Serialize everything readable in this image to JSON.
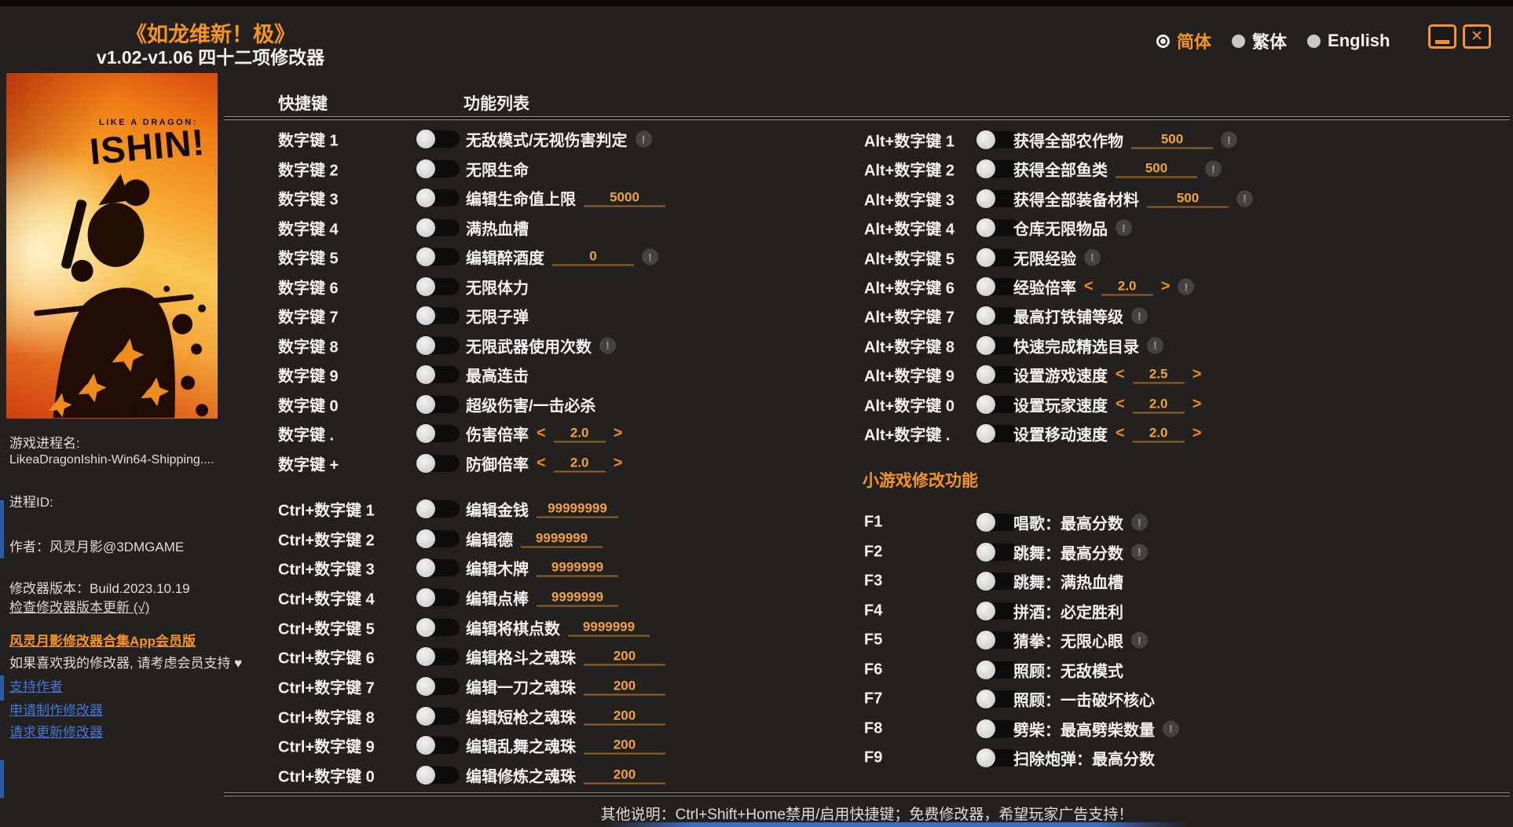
{
  "colors": {
    "accent": "#f7941d",
    "value_orange": "#f2a33c",
    "link_blue": "#4677d4"
  },
  "ui": {
    "spinner_left": "<",
    "spinner_right": ">",
    "warn_glyph": "!",
    "close_glyph": "✕"
  },
  "window": {
    "title": "《如龙维新！极》",
    "subtitle": "v1.02-v1.06 四十二项修改器",
    "languages": [
      {
        "label": "简体",
        "selected": true
      },
      {
        "label": "繁体",
        "selected": false
      },
      {
        "label": "English",
        "selected": false
      }
    ]
  },
  "cover": {
    "logo_line1": "LIKE A DRAGON:",
    "logo_line2": "ISHIN!"
  },
  "sidebar": {
    "process_name_label": "游戏进程名:",
    "process_name_value": "LikeaDragonIshin-Win64-Shipping....",
    "process_id_label": "进程ID:",
    "author": "作者：风灵月影@3DMGAME",
    "version": "修改器版本：Build.2023.10.19",
    "check_update": "检查修改器版本更新 (√)",
    "app_member_link": "风灵月影修改器合集App会员版",
    "support_note": "如果喜欢我的修改器, 请考虑会员支持 ♥",
    "support_link": "支持作者",
    "request_make_link": "申请制作修改器",
    "request_update_link": "请求更新修改器"
  },
  "main": {
    "hotkey_header": "快捷键",
    "function_header": "功能列表",
    "minigame_header": "小游戏修改功能",
    "footer": "其他说明：Ctrl+Shift+Home禁用/启用快捷键；免费修改器，希望玩家广告支持！",
    "left_rows": [
      {
        "hotkey": "数字键 1",
        "label": "无敌模式/无视伤害判定",
        "warn": true
      },
      {
        "hotkey": "数字键 2",
        "label": "无限生命"
      },
      {
        "hotkey": "数字键 3",
        "label": "编辑生命值上限",
        "input": "5000"
      },
      {
        "hotkey": "数字键 4",
        "label": "满热血槽"
      },
      {
        "hotkey": "数字键 5",
        "label": "编辑醉酒度",
        "input": "0",
        "warn": true
      },
      {
        "hotkey": "数字键 6",
        "label": "无限体力"
      },
      {
        "hotkey": "数字键 7",
        "label": "无限子弹"
      },
      {
        "hotkey": "数字键 8",
        "label": "无限武器使用次数",
        "warn": true
      },
      {
        "hotkey": "数字键 9",
        "label": "最高连击"
      },
      {
        "hotkey": "数字键 0",
        "label": "超级伤害/一击必杀"
      },
      {
        "hotkey": "数字键 .",
        "label": "伤害倍率",
        "spinner": "2.0"
      },
      {
        "hotkey": "数字键 +",
        "label": "防御倍率",
        "spinner": "2.0"
      }
    ],
    "ctrl_rows": [
      {
        "hotkey": "Ctrl+数字键 1",
        "label": "编辑金钱",
        "input": "99999999"
      },
      {
        "hotkey": "Ctrl+数字键 2",
        "label": "编辑德",
        "input": "9999999"
      },
      {
        "hotkey": "Ctrl+数字键 3",
        "label": "编辑木牌",
        "input": "9999999"
      },
      {
        "hotkey": "Ctrl+数字键 4",
        "label": "编辑点棒",
        "input": "9999999"
      },
      {
        "hotkey": "Ctrl+数字键 5",
        "label": "编辑将棋点数",
        "input": "9999999"
      },
      {
        "hotkey": "Ctrl+数字键 6",
        "label": "编辑格斗之魂珠",
        "input": "200"
      },
      {
        "hotkey": "Ctrl+数字键 7",
        "label": "编辑一刀之魂珠",
        "input": "200"
      },
      {
        "hotkey": "Ctrl+数字键 8",
        "label": "编辑短枪之魂珠",
        "input": "200"
      },
      {
        "hotkey": "Ctrl+数字键 9",
        "label": "编辑乱舞之魂珠",
        "input": "200"
      },
      {
        "hotkey": "Ctrl+数字键 0",
        "label": "编辑修炼之魂珠",
        "input": "200"
      }
    ],
    "alt_rows": [
      {
        "hotkey": "Alt+数字键 1",
        "label": "获得全部农作物",
        "input": "500",
        "warn": true
      },
      {
        "hotkey": "Alt+数字键 2",
        "label": "获得全部鱼类",
        "input": "500",
        "warn": true
      },
      {
        "hotkey": "Alt+数字键 3",
        "label": "获得全部装备材料",
        "input": "500",
        "warn": true
      },
      {
        "hotkey": "Alt+数字键 4",
        "label": "仓库无限物品",
        "warn": true
      },
      {
        "hotkey": "Alt+数字键 5",
        "label": "无限经验",
        "warn": true
      },
      {
        "hotkey": "Alt+数字键 6",
        "label": "经验倍率",
        "spinner": "2.0",
        "warn": true
      },
      {
        "hotkey": "Alt+数字键 7",
        "label": "最高打铁铺等级",
        "warn": true
      },
      {
        "hotkey": "Alt+数字键 8",
        "label": "快速完成精选目录",
        "warn": true
      },
      {
        "hotkey": "Alt+数字键 9",
        "label": "设置游戏速度",
        "spinner": "2.5"
      },
      {
        "hotkey": "Alt+数字键 0",
        "label": "设置玩家速度",
        "spinner": "2.0"
      },
      {
        "hotkey": "Alt+数字键 .",
        "label": "设置移动速度",
        "spinner": "2.0"
      }
    ],
    "f_rows": [
      {
        "hotkey": "F1",
        "label": "唱歌：最高分数",
        "warn": true
      },
      {
        "hotkey": "F2",
        "label": "跳舞：最高分数",
        "warn": true
      },
      {
        "hotkey": "F3",
        "label": "跳舞：满热血槽"
      },
      {
        "hotkey": "F4",
        "label": "拼酒：必定胜利"
      },
      {
        "hotkey": "F5",
        "label": "猜拳：无限心眼",
        "warn": true
      },
      {
        "hotkey": "F6",
        "label": "照顾：无敌模式"
      },
      {
        "hotkey": "F7",
        "label": "照顾：一击破坏核心"
      },
      {
        "hotkey": "F8",
        "label": "劈柴：最高劈柴数量",
        "warn": true
      },
      {
        "hotkey": "F9",
        "label": "扫除炮弹：最高分数"
      }
    ]
  }
}
